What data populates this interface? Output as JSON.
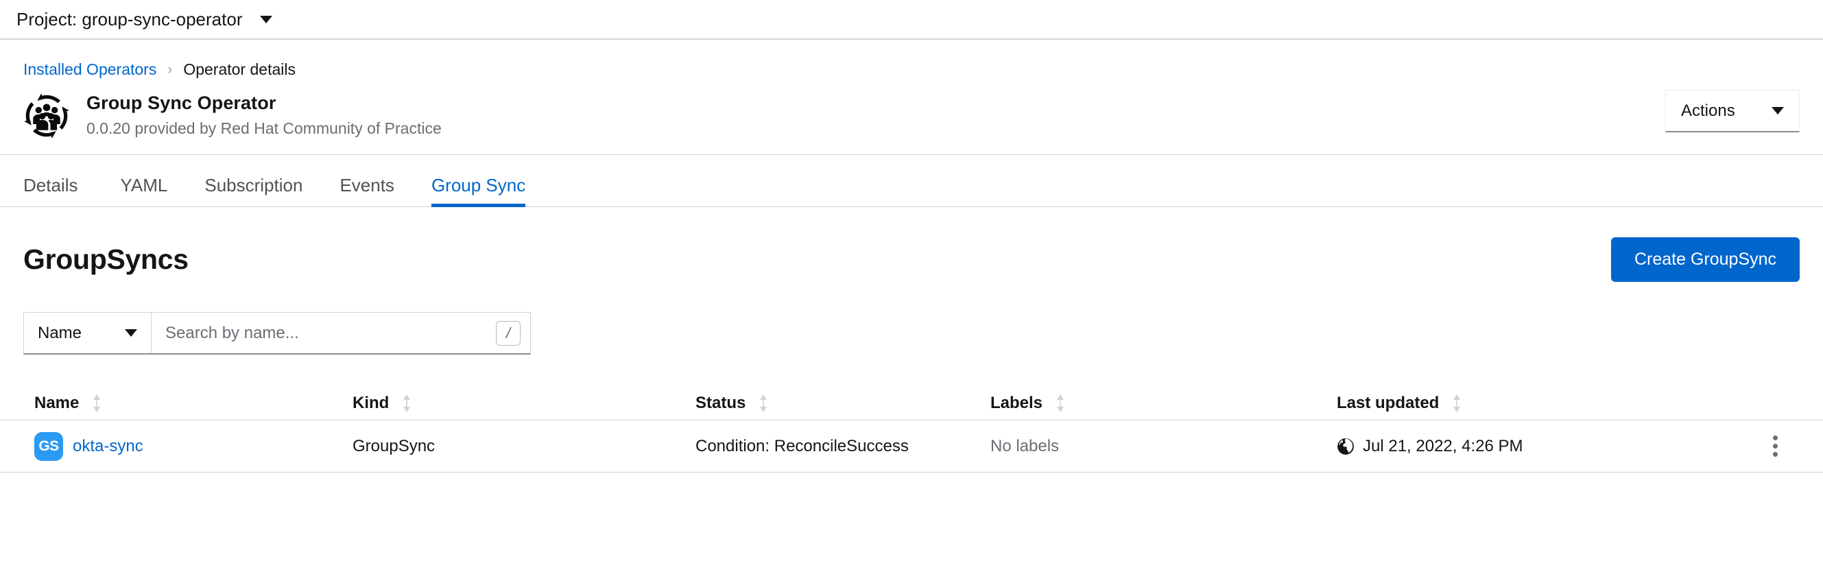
{
  "project_bar": {
    "label": "Project: group-sync-operator",
    "caret_icon": "chevron-down-icon"
  },
  "breadcrumb": {
    "parent": "Installed Operators",
    "separator": "›",
    "current": "Operator details"
  },
  "operator": {
    "logo_icon": "group-sync-operator-logo",
    "name": "Group Sync Operator",
    "subtitle": "0.0.20 provided by Red Hat Community of Practice",
    "actions_label": "Actions",
    "actions_caret_icon": "chevron-down-icon"
  },
  "tabs": [
    {
      "label": "Details",
      "active": false
    },
    {
      "label": "YAML",
      "active": false
    },
    {
      "label": "Subscription",
      "active": false
    },
    {
      "label": "Events",
      "active": false
    },
    {
      "label": "Group Sync",
      "active": true
    }
  ],
  "page": {
    "title": "GroupSyncs",
    "create_label": "Create GroupSync"
  },
  "toolbar": {
    "filter_attribute": "Name",
    "filter_caret_icon": "chevron-down-icon",
    "search_placeholder": "Search by name...",
    "search_value": "",
    "search_icon": "search-input",
    "shortcut_badge": "/"
  },
  "table": {
    "columns": [
      {
        "label": "Name",
        "sort_icon": "sort-arrows-icon"
      },
      {
        "label": "Kind",
        "sort_icon": "sort-arrows-icon"
      },
      {
        "label": "Status",
        "sort_icon": "sort-arrows-icon"
      },
      {
        "label": "Labels",
        "sort_icon": "sort-arrows-icon"
      },
      {
        "label": "Last updated",
        "sort_icon": "sort-arrows-icon"
      }
    ],
    "rows": [
      {
        "badge": "GS",
        "name": "okta-sync",
        "kind": "GroupSync",
        "status": "Condition: ReconcileSuccess",
        "labels": "No labels",
        "last_updated": "Jul 21, 2022, 4:26 PM",
        "timestamp_icon": "globe-icon",
        "kebab_icon": "kebab-menu-icon"
      }
    ]
  },
  "colors": {
    "link": "#0066CC",
    "primary_button": "#0066CC",
    "badge": "#2B9AF3",
    "muted_text": "#6A6E73",
    "border": "#D2D2D2"
  }
}
